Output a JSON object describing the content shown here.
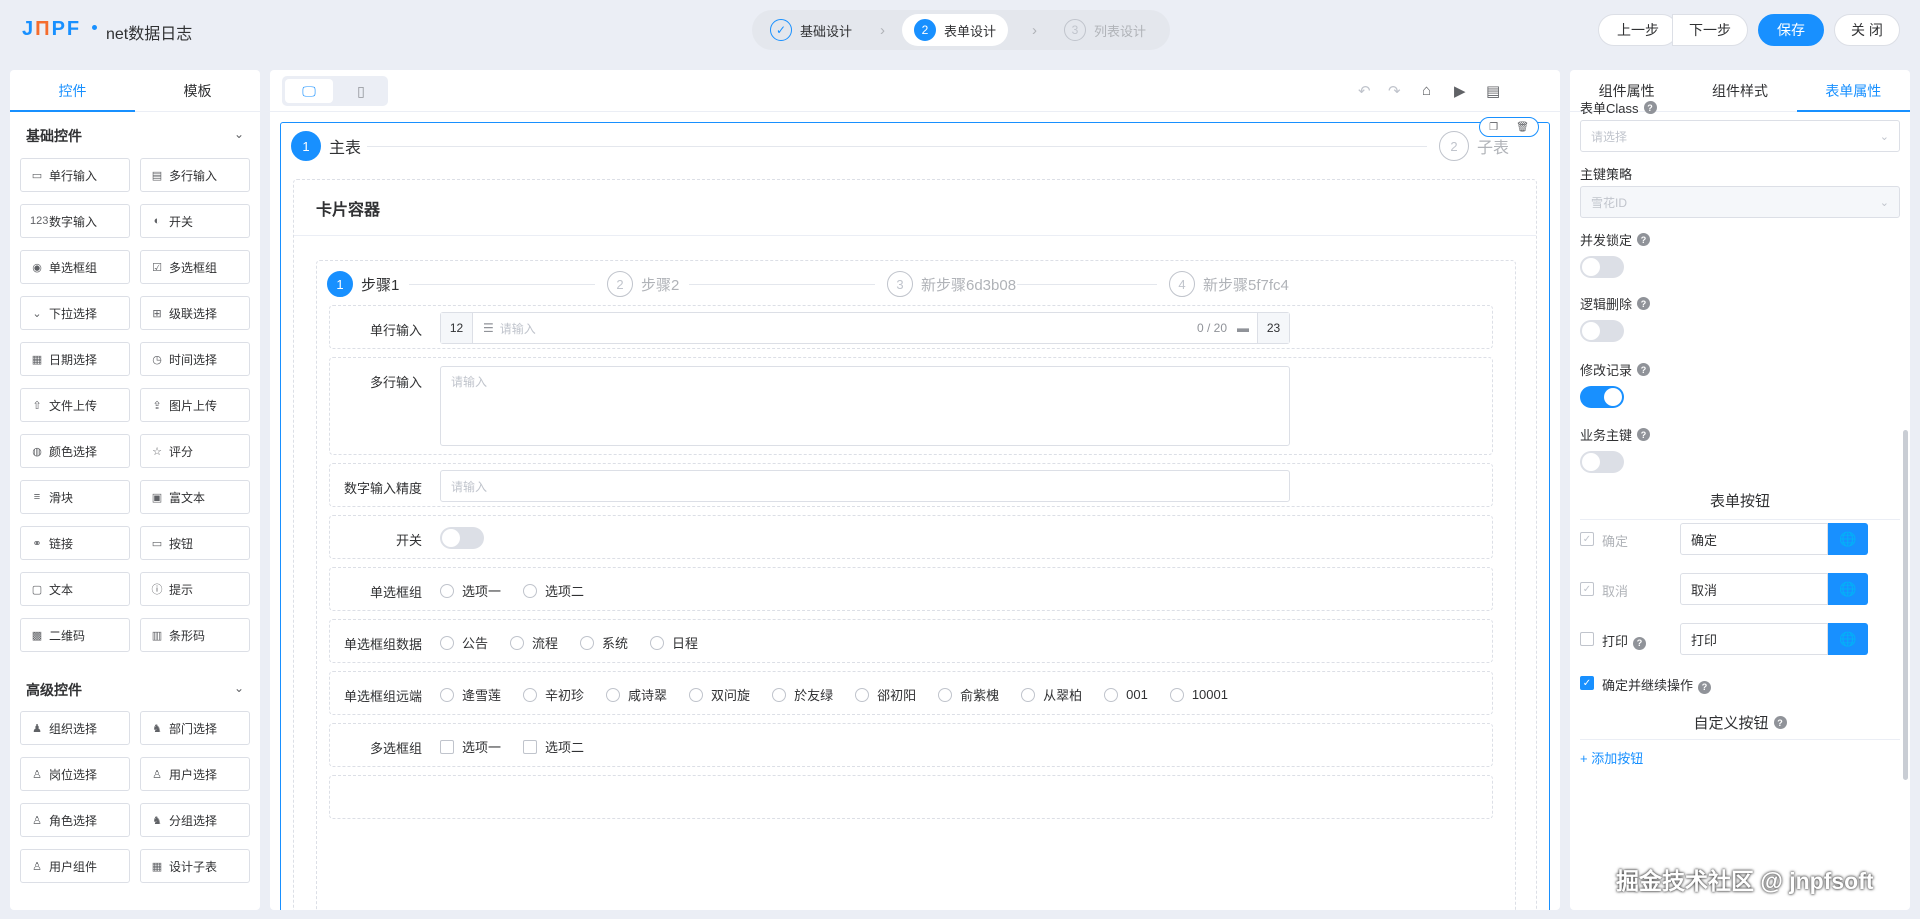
{
  "app": {
    "logo": "JNPF",
    "title": "net数据日志"
  },
  "header_steps": [
    {
      "num": "✓",
      "label": "基础设计",
      "state": "done"
    },
    {
      "num": "2",
      "label": "表单设计",
      "state": "active"
    },
    {
      "num": "3",
      "label": "列表设计",
      "state": "disabled"
    }
  ],
  "header_buttons": {
    "prev": "上一步",
    "next": "下一步",
    "save": "保存",
    "close": "关 闭"
  },
  "left_panel": {
    "tabs": [
      "控件",
      "模板"
    ],
    "basic_title": "基础控件",
    "basic": [
      {
        "icon": "▭",
        "label": "单行输入"
      },
      {
        "icon": "▤",
        "label": "多行输入"
      },
      {
        "icon": "123",
        "label": "数字输入"
      },
      {
        "icon": "◐",
        "label": "开关"
      },
      {
        "icon": "◉",
        "label": "单选框组"
      },
      {
        "icon": "☑",
        "label": "多选框组"
      },
      {
        "icon": "⌄",
        "label": "下拉选择"
      },
      {
        "icon": "⊞",
        "label": "级联选择"
      },
      {
        "icon": "▦",
        "label": "日期选择"
      },
      {
        "icon": "◷",
        "label": "时间选择"
      },
      {
        "icon": "⇧",
        "label": "文件上传"
      },
      {
        "icon": "⇪",
        "label": "图片上传"
      },
      {
        "icon": "◍",
        "label": "颜色选择"
      },
      {
        "icon": "☆",
        "label": "评分"
      },
      {
        "icon": "≡",
        "label": "滑块"
      },
      {
        "icon": "▣",
        "label": "富文本"
      },
      {
        "icon": "⚭",
        "label": "链接"
      },
      {
        "icon": "▭",
        "label": "按钮"
      },
      {
        "icon": "▢",
        "label": "文本"
      },
      {
        "icon": "ⓘ",
        "label": "提示"
      },
      {
        "icon": "▩",
        "label": "二维码"
      },
      {
        "icon": "▥",
        "label": "条形码"
      }
    ],
    "advanced_title": "高级控件",
    "advanced": [
      {
        "icon": "♟",
        "label": "组织选择"
      },
      {
        "icon": "♞",
        "label": "部门选择"
      },
      {
        "icon": "♙",
        "label": "岗位选择"
      },
      {
        "icon": "♙",
        "label": "用户选择"
      },
      {
        "icon": "♙",
        "label": "角色选择"
      },
      {
        "icon": "♞",
        "label": "分组选择"
      },
      {
        "icon": "♙",
        "label": "用户组件"
      },
      {
        "icon": "▦",
        "label": "设计子表"
      }
    ]
  },
  "canvas": {
    "main_steps": [
      {
        "num": "1",
        "label": "主表"
      },
      {
        "num": "2",
        "label": "子表"
      }
    ],
    "card_title": "卡片容器",
    "sub_steps": [
      {
        "num": "1",
        "label": "步骤1"
      },
      {
        "num": "2",
        "label": "步骤2"
      },
      {
        "num": "3",
        "label": "新步骤6d3b08"
      },
      {
        "num": "4",
        "label": "新步骤5f7fc4"
      }
    ],
    "fields": {
      "single_label": "单行输入",
      "single_prefix": "12",
      "single_placeholder": "请输入",
      "single_count": "0 / 20",
      "single_suffix": "23",
      "multi_label": "多行输入",
      "multi_placeholder": "请输入",
      "number_label": "数字输入精度",
      "number_placeholder": "请输入",
      "switch_label": "开关",
      "radio1_label": "单选框组",
      "radio1_options": [
        "选项一",
        "选项二"
      ],
      "radio2_label": "单选框组数据",
      "radio2_options": [
        "公告",
        "流程",
        "系统",
        "日程"
      ],
      "radio3_label": "单选框组远端",
      "radio3_options": [
        "逄雪莲",
        "辛初珍",
        "咸诗翠",
        "双问旋",
        "於友绿",
        "郤初阳",
        "俞紫槐",
        "从翠柏",
        "001",
        "10001"
      ],
      "check_label": "多选框组",
      "check_options": [
        "选项一",
        "选项二"
      ]
    }
  },
  "right_panel": {
    "tabs": [
      "组件属性",
      "组件样式",
      "表单属性"
    ],
    "form_class_label": "表单Class",
    "form_class_placeholder": "请选择",
    "pk_label": "主键策略",
    "pk_value": "雪花ID",
    "concurrency_label": "并发锁定",
    "concurrency_on": false,
    "logic_delete_label": "逻辑删除",
    "logic_delete_on": false,
    "modify_log_label": "修改记录",
    "modify_log_on": true,
    "biz_key_label": "业务主键",
    "biz_key_on": false,
    "form_buttons_title": "表单按钮",
    "buttons": [
      {
        "check_label": "确定",
        "value": "确定",
        "checked": true,
        "disabled": true
      },
      {
        "check_label": "取消",
        "value": "取消",
        "checked": true,
        "disabled": true
      },
      {
        "check_label": "打印",
        "value": "打印",
        "checked": false,
        "disabled": false
      }
    ],
    "continue_label": "确定并继续操作",
    "custom_buttons_title": "自定义按钮",
    "add_label": "+ 添加按钮"
  },
  "watermark": "掘金技术社区 @ jnpfsoft",
  "colors": {
    "primary": "#1890ff",
    "bg": "#ebeef5"
  }
}
